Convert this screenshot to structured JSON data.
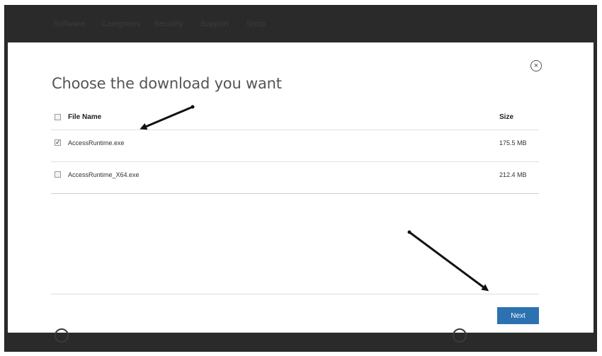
{
  "nav": {
    "items": [
      {
        "label": "Software"
      },
      {
        "label": "Categories"
      },
      {
        "label": "Security"
      },
      {
        "label": "Support"
      },
      {
        "label": "Shop"
      }
    ]
  },
  "dialog": {
    "title": "Choose the download you want",
    "close_icon": "close-circle-icon",
    "close_glyph": "×",
    "table": {
      "header": {
        "name": "File Name",
        "size": "Size",
        "checked": false
      },
      "rows": [
        {
          "name": "AccessRuntime.exe",
          "size": "175.5 MB",
          "checked": true,
          "check_glyph": "✓"
        },
        {
          "name": "AccessRuntime_X64.exe",
          "size": "212.4 MB",
          "checked": false,
          "check_glyph": ""
        }
      ]
    },
    "next_label": "Next"
  },
  "colors": {
    "accent": "#2d72b0",
    "page_dark": "#2a2a2a"
  }
}
